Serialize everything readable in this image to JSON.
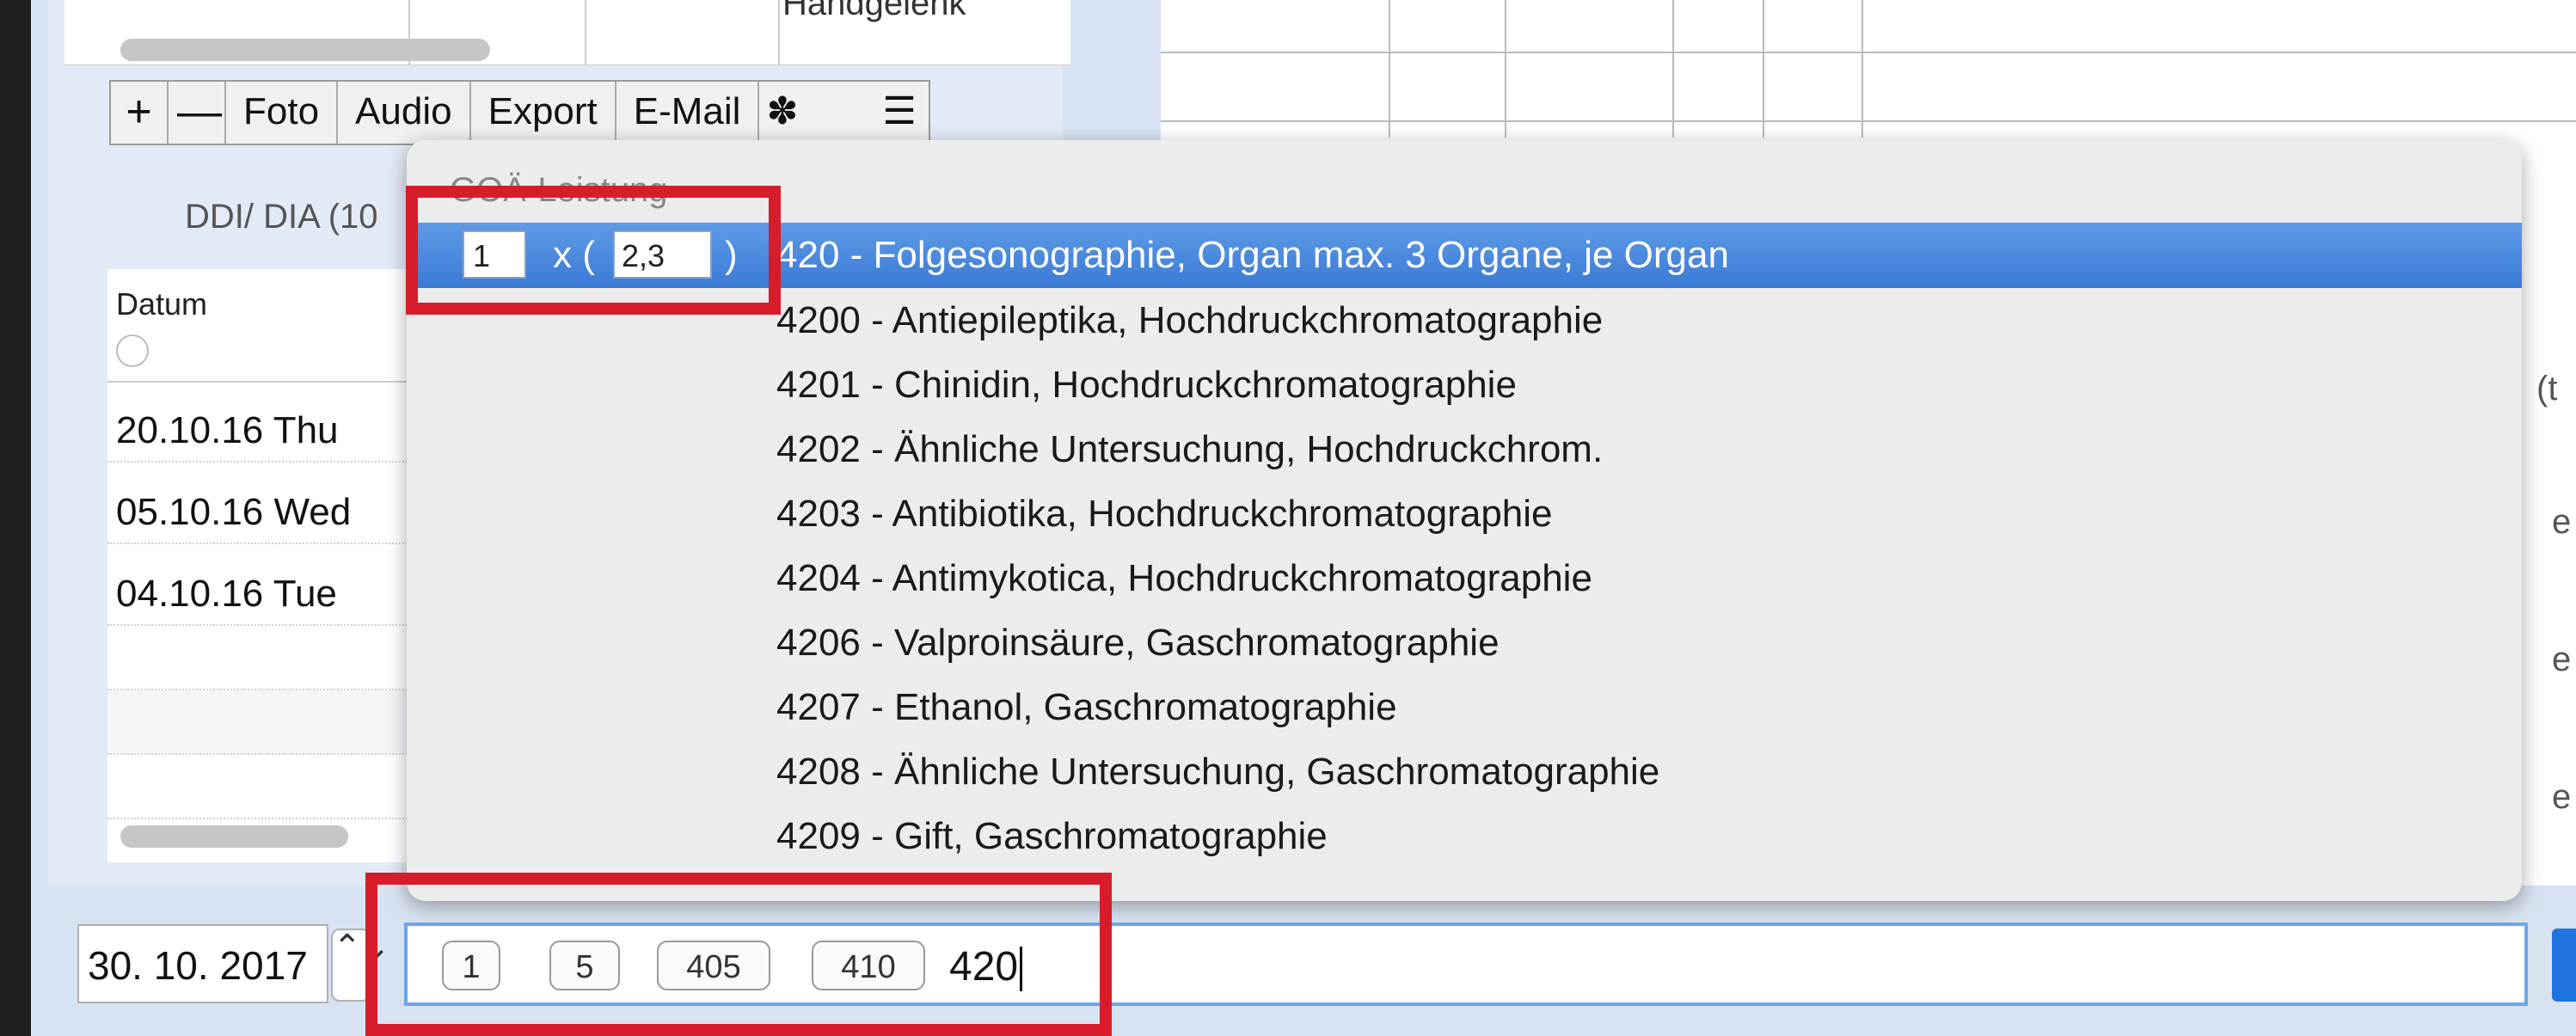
{
  "top_table_clipped_text": "Handgelenk",
  "toolbar": {
    "add": "+",
    "remove": "—",
    "foto": "Foto",
    "audio": "Audio",
    "export": "Export",
    "email": "E-Mail",
    "gear": "✽",
    "lines": "☰"
  },
  "ddi_label": "DDI/ DIA (10",
  "date_table": {
    "header": "Datum",
    "rows": [
      "20.10.16  Thu",
      "05.10.16  Wed",
      "04.10.16  Tue"
    ]
  },
  "right_edge_fragments": [
    "(t",
    "e",
    "e",
    "e"
  ],
  "popup": {
    "title": "GOÄ-Leistung",
    "quantity": "1",
    "x_label": "x (",
    "factor": "2,3",
    "close": ")",
    "selected": "420 - Folgesonographie, Organ max. 3 Organe, je Organ",
    "items": [
      "4200 - Antiepileptika, Hochdruckchromatographie",
      "4201 - Chinidin, Hochdruckchromatographie",
      "4202 - Ähnliche Untersuchung, Hochdruckchrom.",
      "4203 - Antibiotika, Hochdruckchromatographie",
      "4204 - Antimykotica, Hochdruckchromatographie",
      "4206 - Valproinsäure, Gaschromatographie",
      "4207 - Ethanol, Gaschromatographie",
      "4208 - Ähnliche Untersuchung, Gaschromatographie",
      "4209 - Gift, Gaschromatographie"
    ]
  },
  "date_field": "30. 10. 2017",
  "stepper": "⌃⌄",
  "tokens": [
    "1",
    "5",
    "405",
    "410"
  ],
  "typed_text": "420",
  "colors": {
    "highlight": "#3a7bd6",
    "annotation_red": "#d71d2b",
    "focus_ring": "#6ea7ea"
  }
}
